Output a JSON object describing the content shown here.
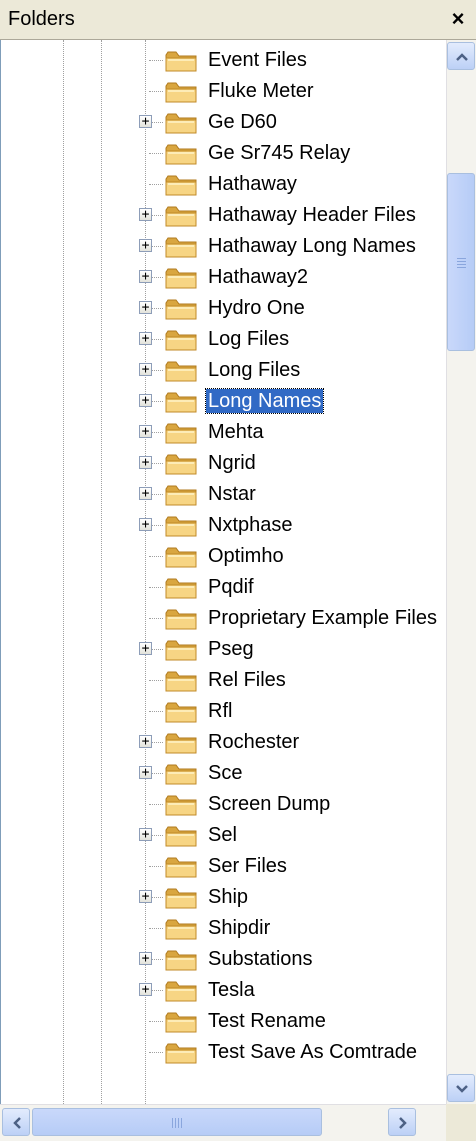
{
  "panel": {
    "title": "Folders",
    "close_glyph": "×",
    "close_icon": "close-icon"
  },
  "colors": {
    "selection": "#316ac5",
    "folder_fill": "#f7d584",
    "folder_dark": "#d9a640",
    "scroll_arrow": "#4d6185"
  },
  "selected_item": "Long Names",
  "items": [
    {
      "label": "Event Files",
      "expandable": false
    },
    {
      "label": "Fluke Meter",
      "expandable": false
    },
    {
      "label": "Ge D60",
      "expandable": true
    },
    {
      "label": "Ge Sr745 Relay",
      "expandable": false
    },
    {
      "label": "Hathaway",
      "expandable": false
    },
    {
      "label": "Hathaway Header Files",
      "expandable": true
    },
    {
      "label": "Hathaway Long Names",
      "expandable": true
    },
    {
      "label": "Hathaway2",
      "expandable": true
    },
    {
      "label": "Hydro One",
      "expandable": true
    },
    {
      "label": "Log Files",
      "expandable": true
    },
    {
      "label": "Long Files",
      "expandable": true
    },
    {
      "label": "Long Names",
      "expandable": true,
      "selected": true
    },
    {
      "label": "Mehta",
      "expandable": true
    },
    {
      "label": "Ngrid",
      "expandable": true
    },
    {
      "label": "Nstar",
      "expandable": true
    },
    {
      "label": "Nxtphase",
      "expandable": true
    },
    {
      "label": "Optimho",
      "expandable": false
    },
    {
      "label": "Pqdif",
      "expandable": false
    },
    {
      "label": "Proprietary Example Files",
      "expandable": false
    },
    {
      "label": "Pseg",
      "expandable": true
    },
    {
      "label": "Rel Files",
      "expandable": false
    },
    {
      "label": "Rfl",
      "expandable": false
    },
    {
      "label": "Rochester",
      "expandable": true
    },
    {
      "label": "Sce",
      "expandable": true
    },
    {
      "label": "Screen Dump",
      "expandable": false
    },
    {
      "label": "Sel",
      "expandable": true
    },
    {
      "label": "Ser Files",
      "expandable": false
    },
    {
      "label": "Ship",
      "expandable": true
    },
    {
      "label": "Shipdir",
      "expandable": false
    },
    {
      "label": "Substations",
      "expandable": true
    },
    {
      "label": "Tesla",
      "expandable": true
    },
    {
      "label": "Test Rename",
      "expandable": false
    },
    {
      "label": "Test Save As Comtrade",
      "expandable": false
    }
  ],
  "expander_glyph": "+",
  "scrollbars": {
    "vertical": {
      "up_icon": "scroll-up-arrow-icon",
      "down_icon": "scroll-down-arrow-icon",
      "position_fraction": 0.13
    },
    "horizontal": {
      "left_icon": "scroll-left-arrow-icon",
      "right_icon": "scroll-right-arrow-icon",
      "position_fraction": 0.0
    }
  }
}
